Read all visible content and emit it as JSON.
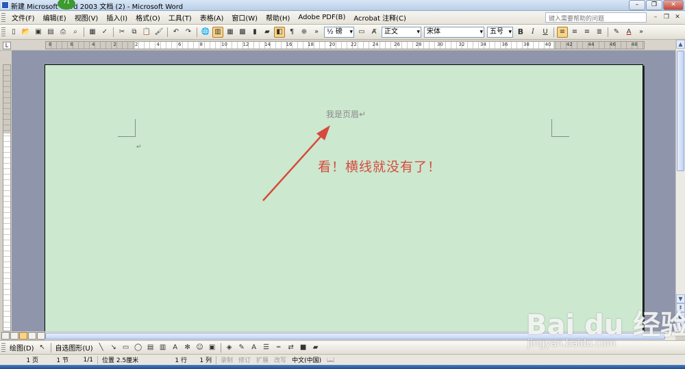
{
  "window": {
    "title": "新建 Microsoft Word 2003 文档 (2) - Microsoft Word",
    "badge": "71"
  },
  "menu": {
    "items": [
      "文件(F)",
      "编辑(E)",
      "视图(V)",
      "插入(I)",
      "格式(O)",
      "工具(T)",
      "表格(A)",
      "窗口(W)",
      "帮助(H)",
      "Adobe PDF(B)",
      "Acrobat 注释(C)"
    ],
    "help_placeholder": "键入需要帮助的问题"
  },
  "toolbar": {
    "line_spacing": "½ 磅",
    "style": "正文",
    "font": "宋体",
    "size": "五号",
    "bold": "B",
    "italic": "I",
    "underline": "U",
    "font_color_label": "A"
  },
  "ruler": {
    "numbers": [
      "8",
      "6",
      "4",
      "2",
      "2",
      "4",
      "6",
      "8",
      "10",
      "12",
      "14",
      "16",
      "18",
      "20",
      "22",
      "24",
      "26",
      "28",
      "30",
      "32",
      "34",
      "36",
      "38",
      "40",
      "42",
      "44",
      "46",
      "48"
    ]
  },
  "document": {
    "header_text": "我是页眉↵",
    "paragraph_mark": "↵",
    "annotation": "看！横线就没有了！"
  },
  "drawbar": {
    "draw_label": "绘图(D)",
    "autoshapes_label": "自选图形(U)"
  },
  "status": {
    "page": "1 页",
    "section": "1 节",
    "page_of": "1/1",
    "position": "位置 2.5厘米",
    "line": "1 行",
    "column": "1 列",
    "rec": "录制",
    "trk": "修订",
    "ext": "扩展",
    "ovr": "改写",
    "language": "中文(中国)"
  },
  "watermark": {
    "logo": "Bai du 经验",
    "url": "jingyan.baidu.com"
  },
  "colors": {
    "page_background": "#cce8cf",
    "annotation_red": "#d64a3c",
    "active_button": "#f8d48a"
  }
}
